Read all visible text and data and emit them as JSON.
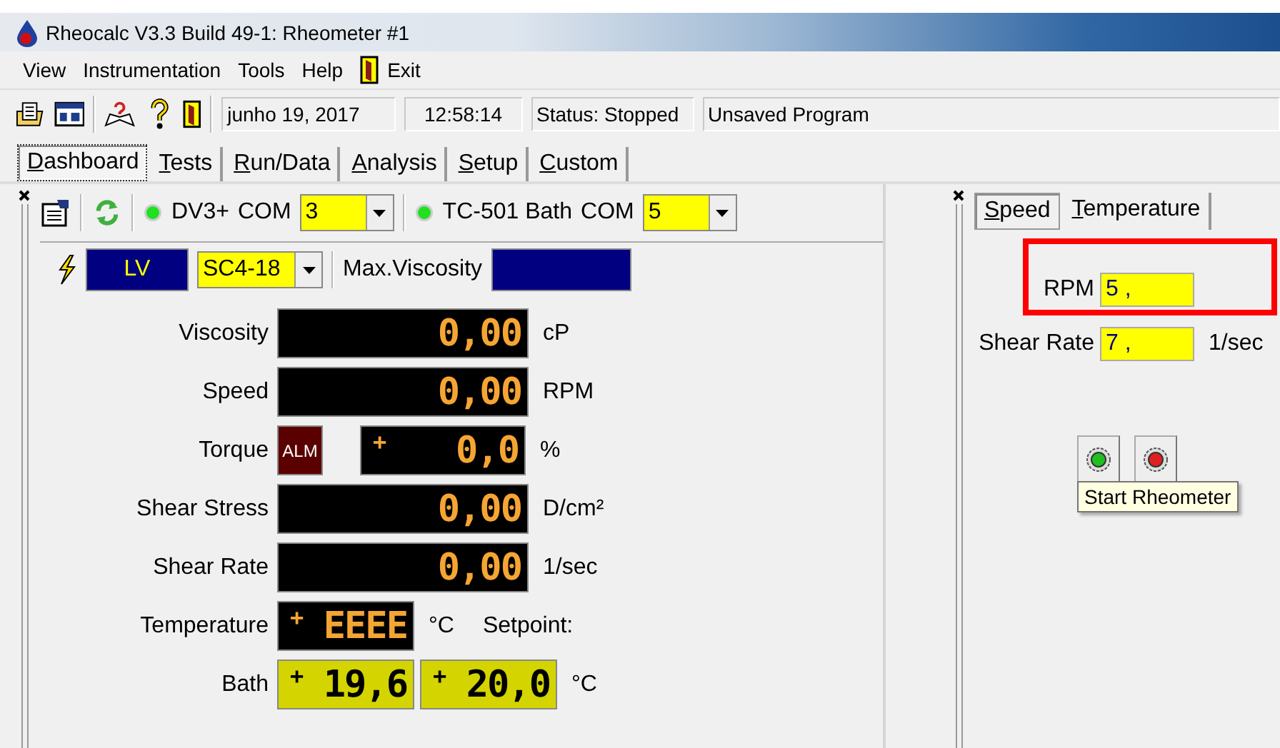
{
  "window": {
    "title": "Rheocalc V3.3 Build 49-1: Rheometer #1"
  },
  "menu": [
    {
      "label": "View",
      "kind": "text"
    },
    {
      "label": "Instrumentation",
      "kind": "text"
    },
    {
      "label": "Tools",
      "kind": "text"
    },
    {
      "label": "Help",
      "kind": "text"
    },
    {
      "label": "Exit",
      "kind": "exit"
    }
  ],
  "toolbar": {
    "date": "junho 19, 2017",
    "time": "12:58:14",
    "status": "Status: Stopped",
    "program": "Unsaved Program"
  },
  "tabs": [
    {
      "label": "Dashboard",
      "selected": true
    },
    {
      "label": "Tests",
      "selected": false
    },
    {
      "label": "Run/Data",
      "selected": false
    },
    {
      "label": "Analysis",
      "selected": false
    },
    {
      "label": "Setup",
      "selected": false
    },
    {
      "label": "Custom",
      "selected": false
    }
  ],
  "devices": [
    {
      "name": "DV3+",
      "com_label": "COM",
      "com": "3",
      "connected": true
    },
    {
      "name": "TC-501 Bath",
      "com_label": "COM",
      "com": "5",
      "connected": true
    }
  ],
  "spindle": {
    "range": "LV",
    "spindle": "SC4-18",
    "max_label": "Max.Viscosity"
  },
  "readings": [
    {
      "kind": "plain",
      "label": "Viscosity",
      "value": "0,00",
      "unit": "cP"
    },
    {
      "kind": "plain",
      "label": "Speed",
      "value": "0,00",
      "unit": "RPM"
    },
    {
      "kind": "torque",
      "label": "Torque",
      "alarm": "ALM",
      "sign": "+",
      "value": "0,0",
      "unit": "%"
    },
    {
      "kind": "plain",
      "label": "Shear Stress",
      "value": "0,00",
      "unit": "D/cm²"
    },
    {
      "kind": "plain",
      "label": "Shear Rate",
      "value": "0,00",
      "unit": "1/sec"
    },
    {
      "kind": "temperature",
      "label": "Temperature",
      "sign": "+",
      "value": "EEEE",
      "unit": "°C",
      "setpoint_label": "Setpoint:"
    },
    {
      "kind": "bath",
      "label": "Bath",
      "displays": [
        {
          "sign": "+",
          "value": "19,6"
        },
        {
          "sign": "+",
          "value": "20,0"
        }
      ],
      "unit": "°C"
    }
  ],
  "control": {
    "tabs": [
      {
        "label": "Speed",
        "selected": true
      },
      {
        "label": "Temperature",
        "selected": false
      }
    ],
    "fields": [
      {
        "label": "RPM",
        "value": "5 ,",
        "highlighted": true
      },
      {
        "label": "Shear Rate",
        "value": "7 ,",
        "unit": "1/sec",
        "highlighted": false
      }
    ],
    "buttons": [
      {
        "kind": "start"
      },
      {
        "kind": "stop"
      }
    ],
    "tooltip": "Start Rheometer"
  }
}
